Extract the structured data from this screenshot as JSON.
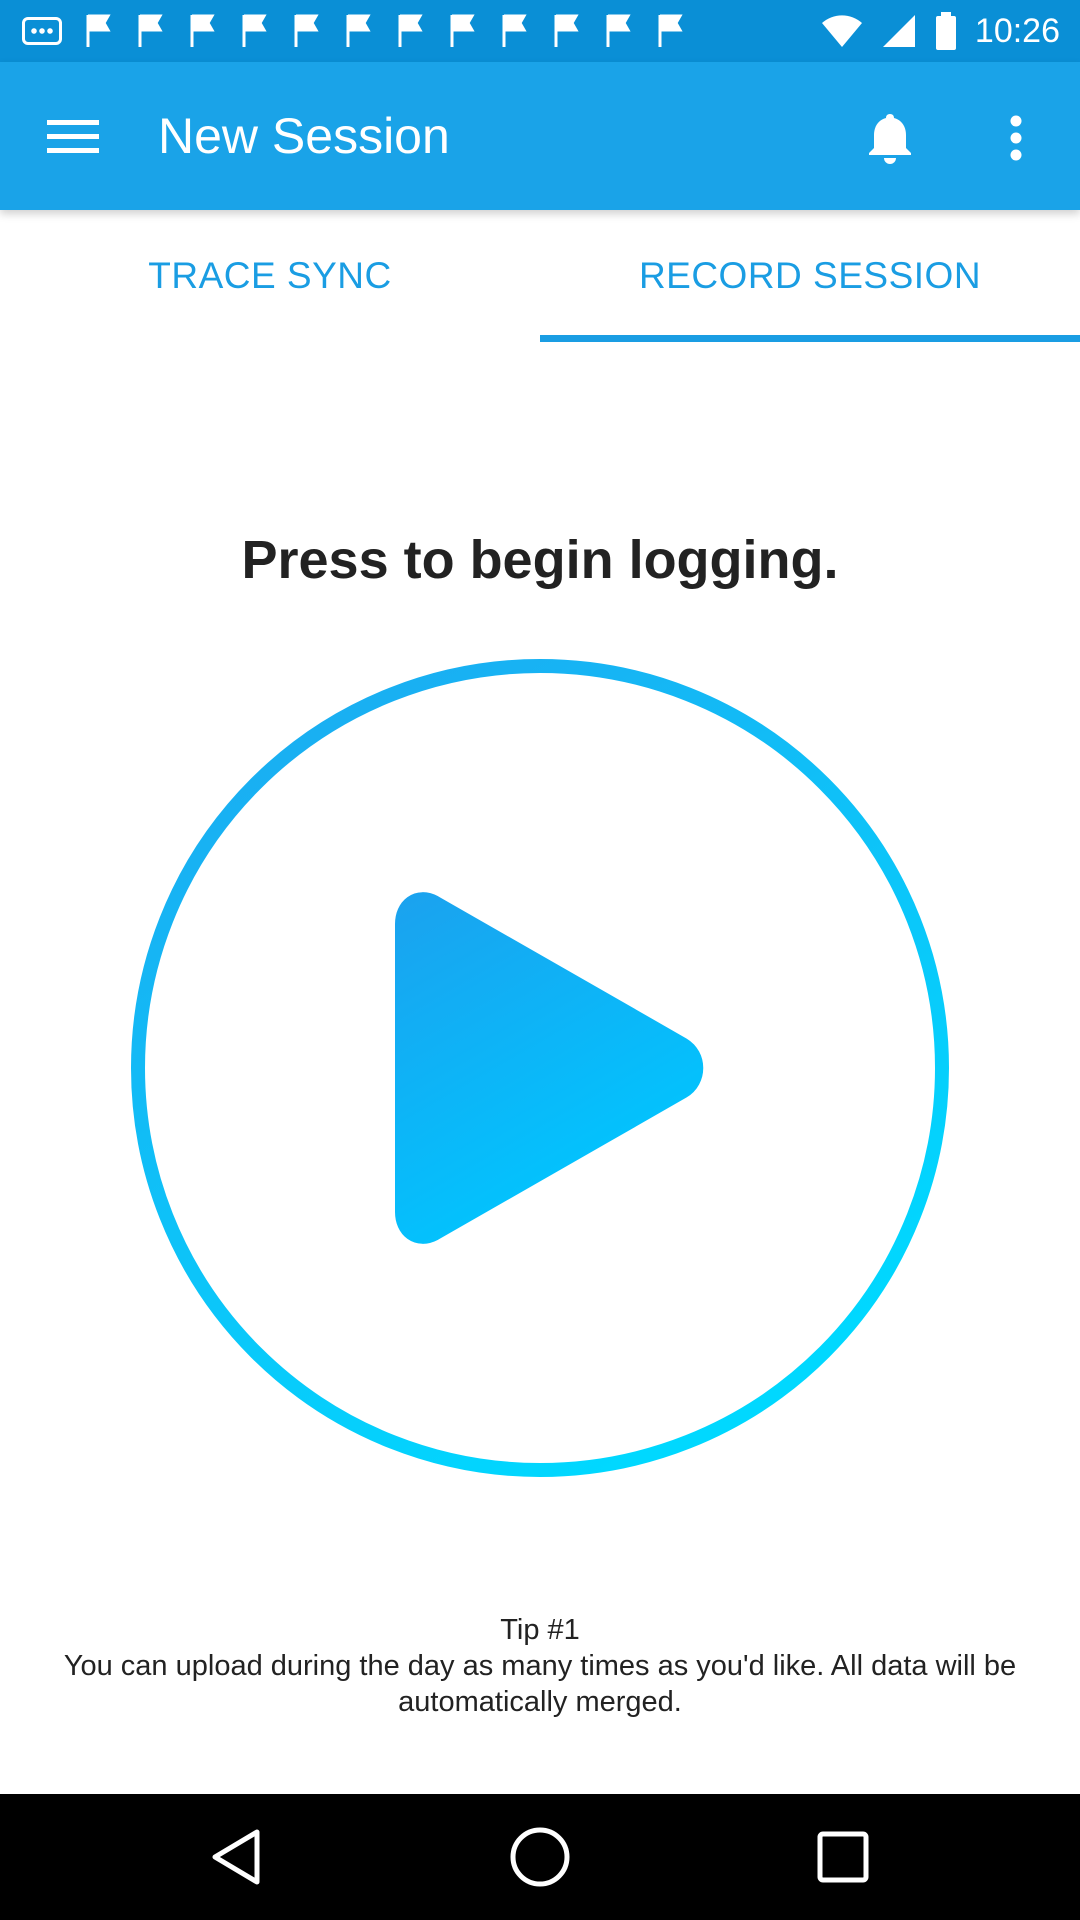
{
  "status_bar": {
    "time": "10:26",
    "notification_icons": [
      "message-icon",
      "flag-icon",
      "flag-icon",
      "flag-icon",
      "flag-icon",
      "flag-icon",
      "flag-icon",
      "flag-icon",
      "flag-icon",
      "flag-icon",
      "flag-icon",
      "flag-icon",
      "flag-icon"
    ],
    "system_icons": [
      "wifi-icon",
      "signal-icon",
      "battery-icon"
    ]
  },
  "app_bar": {
    "title": "New Session",
    "menu_icon": "hamburger-menu-icon",
    "bell_icon": "bell-icon",
    "more_icon": "more-vertical-icon"
  },
  "tabs": [
    {
      "label": "TRACE SYNC",
      "selected": false
    },
    {
      "label": "RECORD SESSION",
      "selected": true
    }
  ],
  "main": {
    "prompt": "Press to begin logging.",
    "play_icon": "play-icon"
  },
  "tip": {
    "title": "Tip #1",
    "body": "You can upload during the day as many times as you'd like. All data will be automatically merged."
  },
  "nav_bar": {
    "buttons": [
      "back-icon",
      "home-icon",
      "recents-icon"
    ]
  },
  "colors": {
    "status_bar": "#0a8fd6",
    "app_bar": "#1aa3e8",
    "accent": "#1a9de3",
    "play_gradient_start": "#1ea8f0",
    "play_gradient_end": "#00d2ff"
  }
}
